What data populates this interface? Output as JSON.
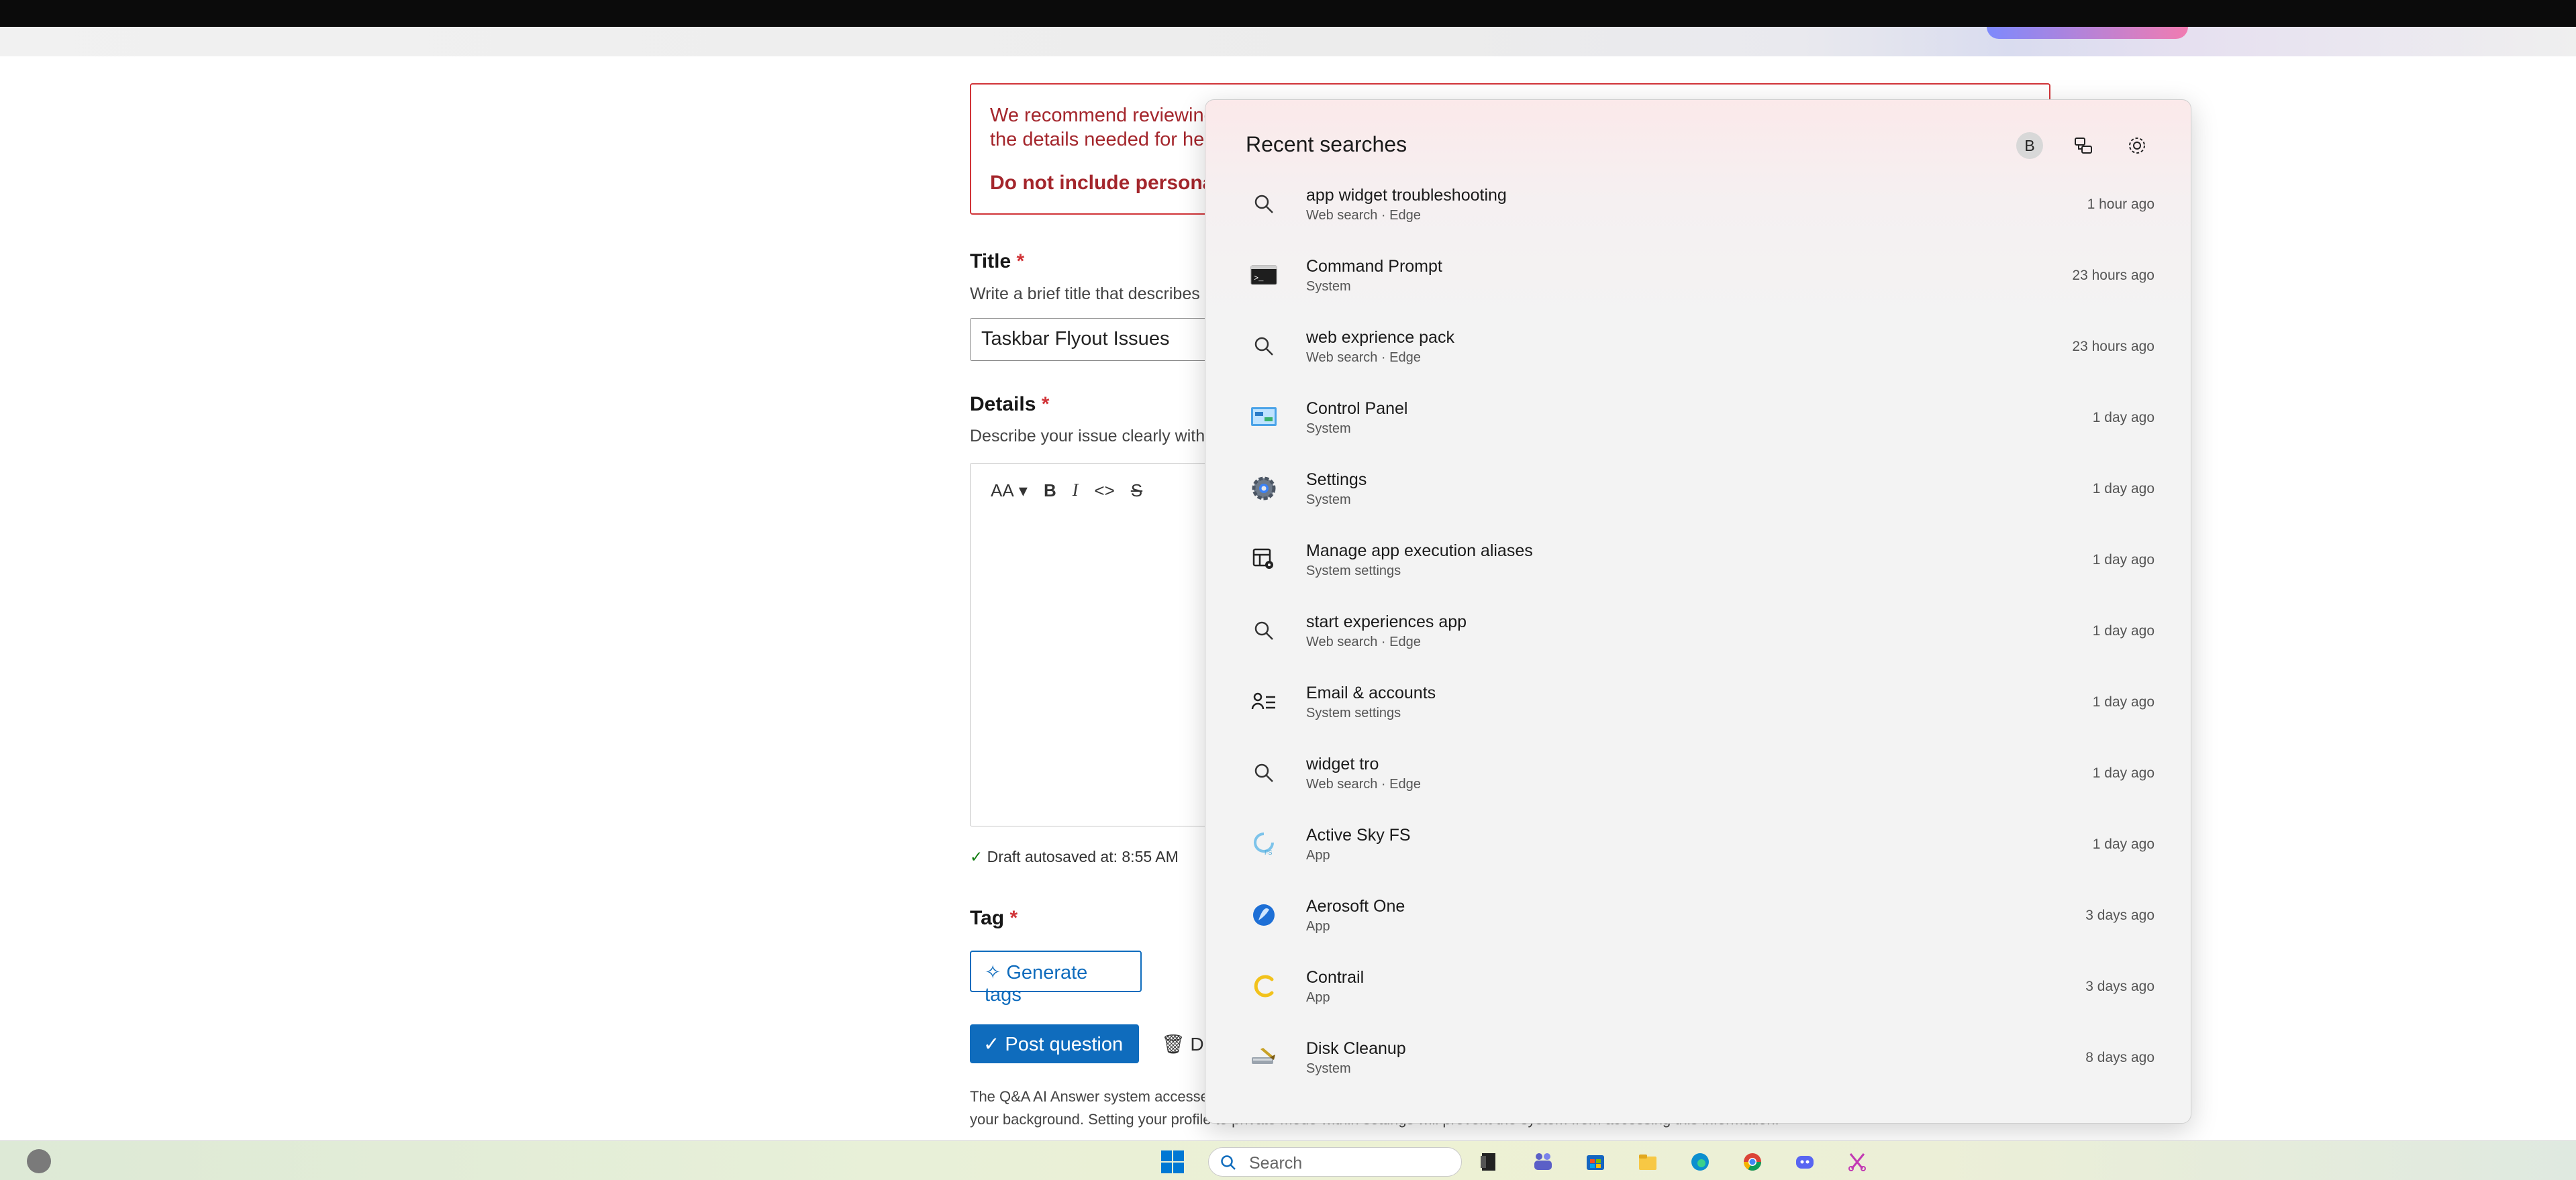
{
  "page": {
    "warning": {
      "line1": "We recommend reviewing",
      "line2": "the details needed for hel",
      "line3": "Do not include personal,"
    },
    "title_label": "Title",
    "required_mark": "*",
    "title_help": "Write a brief title that describes",
    "title_value": "Taskbar Flyout Issues",
    "details_label": "Details",
    "details_help": "Describe your issue clearly witho",
    "editor_toolbar": {
      "font_size": "AA",
      "bold": "B",
      "italic": "I",
      "code": "<>",
      "strike": "S"
    },
    "autosave": "Draft autosaved at: 8:55 AM",
    "tag_label": "Tag",
    "generate_tags": "Generate tags",
    "post_question": "Post question",
    "discard": "Di",
    "footer_line1": "The Q&A AI Answer system accesses",
    "footer_line2": "your background. Setting your profile to private mode within settings will prevent the system from accessing this information."
  },
  "flyout": {
    "title": "Recent searches",
    "avatar_letter": "B",
    "items": [
      {
        "name": "app widget troubleshooting",
        "sub": "Web search · Edge",
        "time": "1 hour ago",
        "icon": "search-icon"
      },
      {
        "name": "Command Prompt",
        "sub": "System",
        "time": "23 hours ago",
        "icon": "command-prompt-icon"
      },
      {
        "name": "web exprience pack",
        "sub": "Web search · Edge",
        "time": "23 hours ago",
        "icon": "search-icon"
      },
      {
        "name": "Control Panel",
        "sub": "System",
        "time": "1 day ago",
        "icon": "control-panel-icon"
      },
      {
        "name": "Settings",
        "sub": "System",
        "time": "1 day ago",
        "icon": "settings-gear-icon"
      },
      {
        "name": "Manage app execution aliases",
        "sub": "System settings",
        "time": "1 day ago",
        "icon": "app-aliases-icon"
      },
      {
        "name": "start experiences app",
        "sub": "Web search · Edge",
        "time": "1 day ago",
        "icon": "search-icon"
      },
      {
        "name": "Email & accounts",
        "sub": "System settings",
        "time": "1 day ago",
        "icon": "accounts-icon"
      },
      {
        "name": "widget tro",
        "sub": "Web search · Edge",
        "time": "1 day ago",
        "icon": "search-icon"
      },
      {
        "name": "Active Sky FS",
        "sub": "App",
        "time": "1 day ago",
        "icon": "active-sky-icon"
      },
      {
        "name": "Aerosoft One",
        "sub": "App",
        "time": "3 days ago",
        "icon": "aerosoft-icon"
      },
      {
        "name": "Contrail",
        "sub": "App",
        "time": "3 days ago",
        "icon": "contrail-icon"
      },
      {
        "name": "Disk Cleanup",
        "sub": "System",
        "time": "8 days ago",
        "icon": "disk-cleanup-icon"
      }
    ]
  },
  "taskbar": {
    "search_placeholder": "Search",
    "pinned": [
      "start-icon",
      "task-view-icon",
      "teams-icon",
      "store-icon",
      "file-explorer-icon",
      "edge-icon",
      "chrome-icon",
      "discord-icon",
      "snipping-tool-icon"
    ]
  },
  "colors": {
    "accent": "#0f6cbd",
    "error": "#d13438"
  }
}
